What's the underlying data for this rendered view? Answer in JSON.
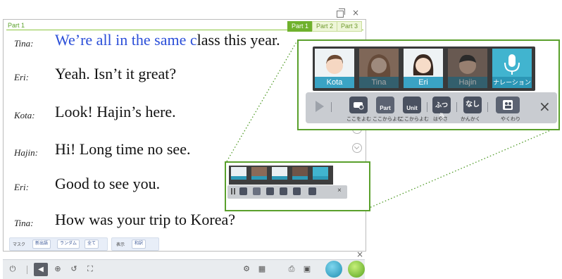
{
  "window": {
    "part_label": "Part 1",
    "tabs": [
      {
        "label": "Part 1",
        "active": true
      },
      {
        "label": "Part 2",
        "active": false
      },
      {
        "label": "Part 3",
        "active": false
      }
    ],
    "close_icon": "×"
  },
  "dialogue": [
    {
      "speaker": "Tina:",
      "highlight": "We’re all in the same c",
      "text": "lass this year."
    },
    {
      "speaker": "Eri:",
      "highlight": "",
      "text": "Yeah.  Isn’t it great?"
    },
    {
      "speaker": "Kota:",
      "highlight": "",
      "text": "Look!  Hajin’s here."
    },
    {
      "speaker": "Hajin:",
      "highlight": "",
      "text": "Hi!  Long time no see."
    },
    {
      "speaker": "Eri:",
      "highlight": "",
      "text": "Good to see you."
    },
    {
      "speaker": "Tina:",
      "highlight": "",
      "text": "How was your trip to Korea?"
    }
  ],
  "mask_bar": {
    "label": "マスク",
    "buttons": [
      "新出語",
      "ランダム",
      "全て"
    ],
    "display_label": "表示",
    "translation_button": "和訳"
  },
  "toolbar": {
    "left_icons": [
      "power-icon",
      "sound-icon",
      "zoom-icon",
      "undo-icon",
      "fit-icon"
    ],
    "right_icons": [
      "settings-icon",
      "grid-icon",
      "print-icon",
      "window-icon"
    ],
    "round_buttons": [
      "cube-icon",
      "pen-icon"
    ],
    "colors": {
      "sound_button": "#5c6068",
      "accent_green": "#5aa02c"
    }
  },
  "characters": [
    {
      "name": "Kota",
      "dim": false
    },
    {
      "name": "Tina",
      "dim": true
    },
    {
      "name": "Eri",
      "dim": false
    },
    {
      "name": "Hajin",
      "dim": true
    },
    {
      "name": "ナレーション",
      "dim": false
    }
  ],
  "controls": {
    "buttons": [
      {
        "text": "",
        "label": "ここをよむ"
      },
      {
        "text": "Part",
        "label": "ここからよむ"
      },
      {
        "text": "Unit",
        "label": "ここからよむ"
      },
      {
        "text": "ふつう",
        "label": "はやさ"
      },
      {
        "text": "なし",
        "label": "かんかく"
      },
      {
        "text": "",
        "label": "やくわり"
      }
    ],
    "close": "×"
  }
}
